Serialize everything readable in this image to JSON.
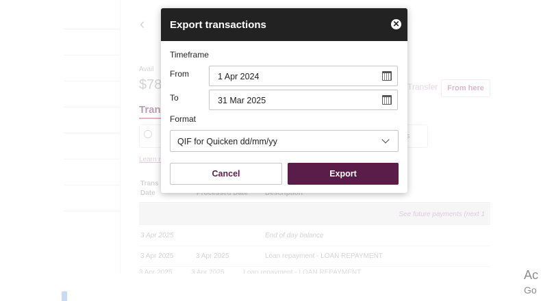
{
  "background": {
    "available_label": "Avail",
    "amount": "$78",
    "transfer_link": "Transfer",
    "from_here_button": "From here",
    "tab_label": "Trans",
    "search_trailing": "s",
    "learn_link": "Learn m",
    "table": {
      "headers": {
        "col1": "Trans\nDate",
        "col2": "Processed Date",
        "col3": "Description"
      },
      "future_row": "See future payments (next 1",
      "rows": [
        {
          "transaction_date": "3 Apr 2025",
          "processed_date": "",
          "description": "End of day balance",
          "italic": true
        },
        {
          "transaction_date": "3 Apr 2025",
          "processed_date": "3 Apr 2025",
          "description": "Loan repayment - LOAN REPAYMENT",
          "italic": false
        }
      ],
      "partial_row": "3 Apr 2025          3 Apr 2025          Loan repayment - LOAN REPAYMENT"
    }
  },
  "watermark": {
    "line1": "Ac",
    "line2": "Go"
  },
  "modal": {
    "title": "Export transactions",
    "close_icon": "close-icon",
    "timeframe_label": "Timeframe",
    "from_label": "From",
    "from_value": "1 Apr 2024",
    "to_label": "To",
    "to_value": "31 Mar 2025",
    "calendar_icon": "calendar-icon",
    "format_label": "Format",
    "format_value": "QIF for Quicken dd/mm/yy",
    "cancel_label": "Cancel",
    "export_label": "Export"
  },
  "colors": {
    "header_bg": "#222222",
    "brand": "#5a1c48",
    "accent_text": "#5b1d4b"
  }
}
